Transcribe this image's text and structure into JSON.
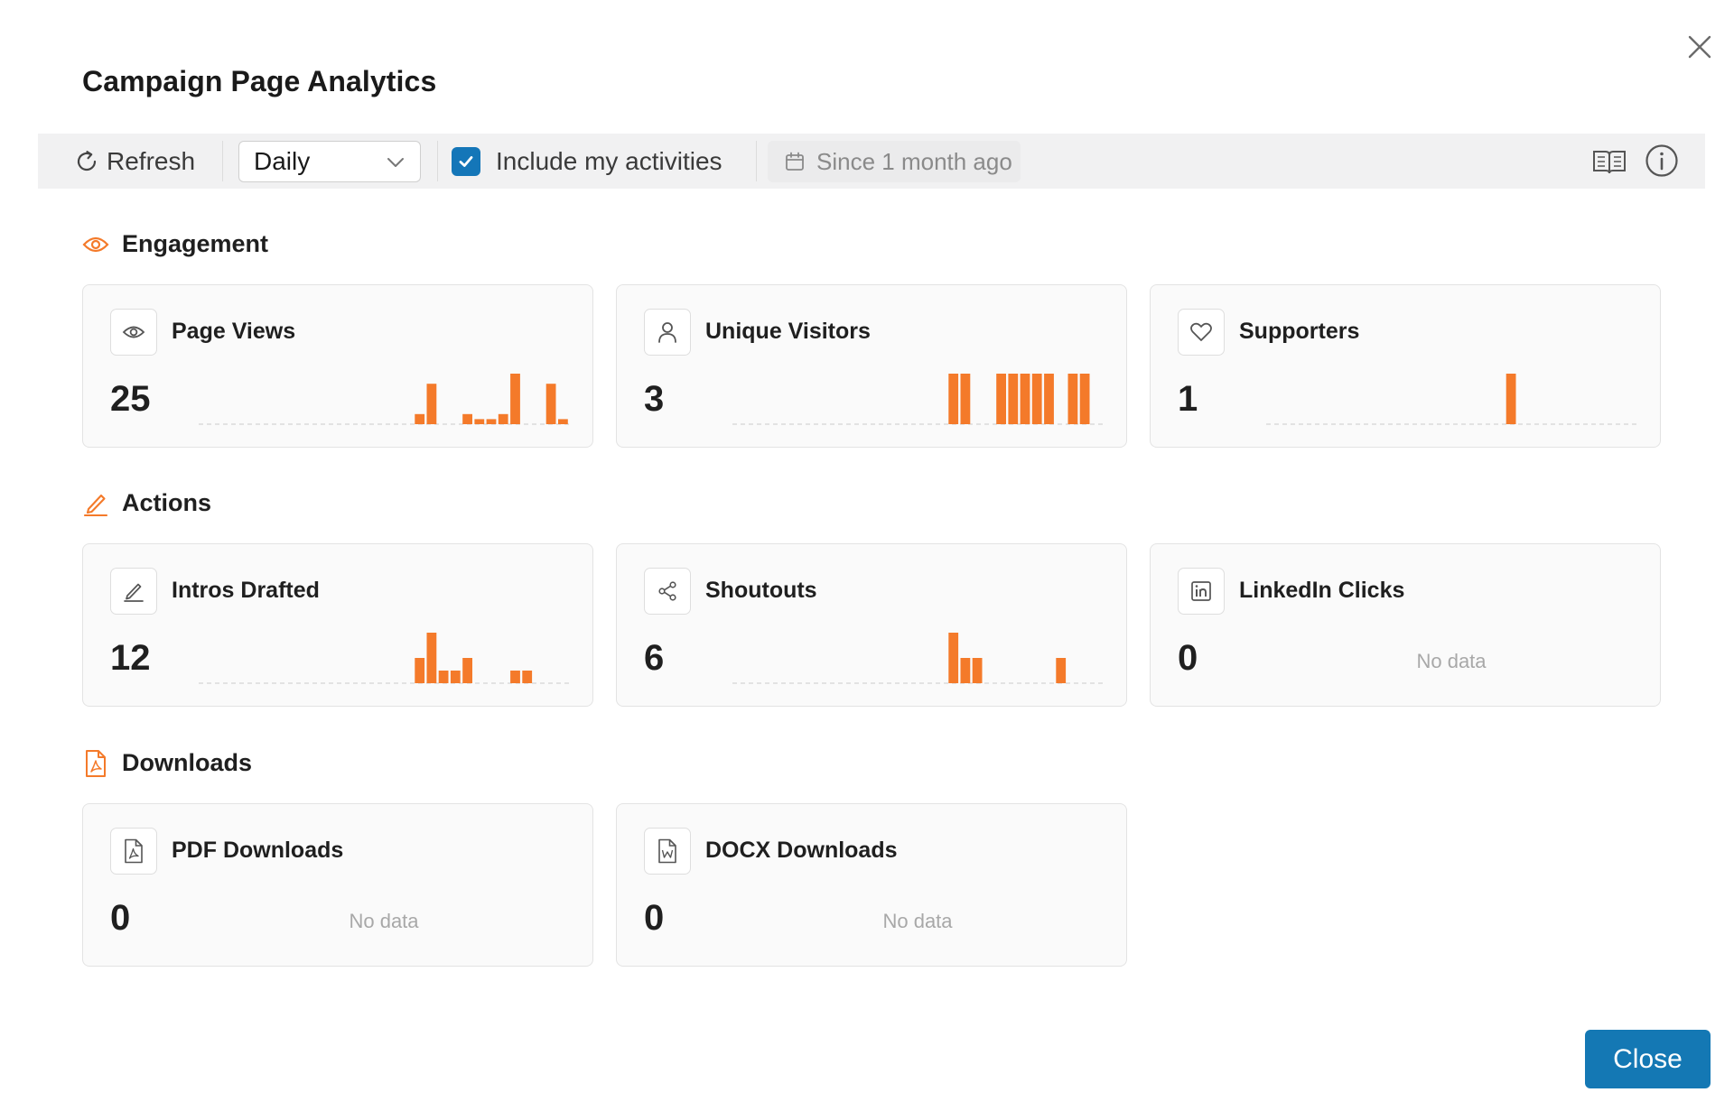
{
  "dialog": {
    "title": "Campaign Page Analytics",
    "close_icon": "close-icon",
    "close_button_label": "Close"
  },
  "toolbar": {
    "refresh_label": "Refresh",
    "interval_value": "Daily",
    "include_label": "Include my activities",
    "include_checked": true,
    "date_range": "Since 1 month ago",
    "guide_icon": "book-icon",
    "info_icon": "info-icon"
  },
  "colors": {
    "accent": "#f47a2a",
    "primary": "#1478b4",
    "card_bg": "#fafafa"
  },
  "sections": {
    "engagement": {
      "title": "Engagement",
      "icon": "eye-icon"
    },
    "actions": {
      "title": "Actions",
      "icon": "pencil-icon"
    },
    "downloads": {
      "title": "Downloads",
      "icon": "pdf-file-icon"
    }
  },
  "metrics": {
    "page_views": {
      "title": "Page Views",
      "value": "25",
      "icon": "eye-icon",
      "series": [
        0,
        0,
        0,
        0,
        0,
        0,
        0,
        0,
        0,
        0,
        0,
        0,
        0,
        0,
        0,
        0,
        0,
        0,
        1,
        4,
        0,
        0,
        1,
        0.5,
        0.5,
        1,
        5,
        0,
        0,
        4,
        0.5
      ]
    },
    "unique_visitors": {
      "title": "Unique Visitors",
      "value": "3",
      "icon": "user-icon",
      "series": [
        0,
        0,
        0,
        0,
        0,
        0,
        0,
        0,
        0,
        0,
        0,
        0,
        0,
        0,
        0,
        0,
        0,
        0,
        1,
        1,
        0,
        0,
        1,
        1,
        1,
        1,
        1,
        0,
        1,
        1,
        0
      ]
    },
    "supporters": {
      "title": "Supporters",
      "value": "1",
      "icon": "heart-icon",
      "series": [
        0,
        0,
        0,
        0,
        0,
        0,
        0,
        0,
        0,
        0,
        0,
        0,
        0,
        0,
        0,
        0,
        0,
        0,
        0,
        0,
        1,
        0,
        0,
        0,
        0,
        0,
        0,
        0,
        0,
        0,
        0
      ]
    },
    "intros_drafted": {
      "title": "Intros Drafted",
      "value": "12",
      "icon": "pencil-icon",
      "series": [
        0,
        0,
        0,
        0,
        0,
        0,
        0,
        0,
        0,
        0,
        0,
        0,
        0,
        0,
        0,
        0,
        0,
        0,
        2,
        4,
        1,
        1,
        2,
        0,
        0,
        0,
        1,
        1,
        0,
        0,
        0
      ]
    },
    "shoutouts": {
      "title": "Shoutouts",
      "value": "6",
      "icon": "share-icon",
      "series": [
        0,
        0,
        0,
        0,
        0,
        0,
        0,
        0,
        0,
        0,
        0,
        0,
        0,
        0,
        0,
        0,
        0,
        0,
        2,
        1,
        1,
        0,
        0,
        0,
        0,
        0,
        0,
        1,
        0,
        0,
        0
      ]
    },
    "linkedin_clicks": {
      "title": "LinkedIn Clicks",
      "value": "0",
      "icon": "linkedin-icon",
      "no_data": "No data"
    },
    "pdf_downloads": {
      "title": "PDF Downloads",
      "value": "0",
      "icon": "pdf-file-icon",
      "no_data": "No data"
    },
    "docx_downloads": {
      "title": "DOCX Downloads",
      "value": "0",
      "icon": "docx-file-icon",
      "no_data": "No data"
    }
  }
}
